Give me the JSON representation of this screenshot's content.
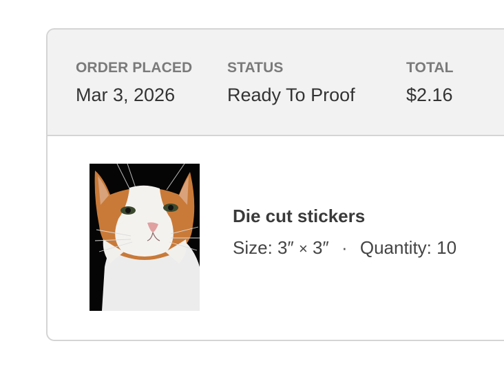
{
  "order": {
    "placed_label": "ORDER PLACED",
    "placed_value": "Mar 3, 2026",
    "status_label": "STATUS",
    "status_value": "Ready To Proof",
    "total_label": "TOTAL",
    "total_value": "$2.16"
  },
  "item": {
    "name": "Die cut stickers",
    "size_label": "Size:",
    "width": "3″",
    "times": "×",
    "height": "3″",
    "separator": "·",
    "quantity_label": "Quantity:",
    "quantity_value": "10",
    "image_subject": "orange-and-white-cat-photo"
  },
  "colors": {
    "header_bg": "#f2f2f2",
    "border": "#d4d4d4",
    "label_gray": "#7a7a7a",
    "text_dark": "#333333"
  }
}
